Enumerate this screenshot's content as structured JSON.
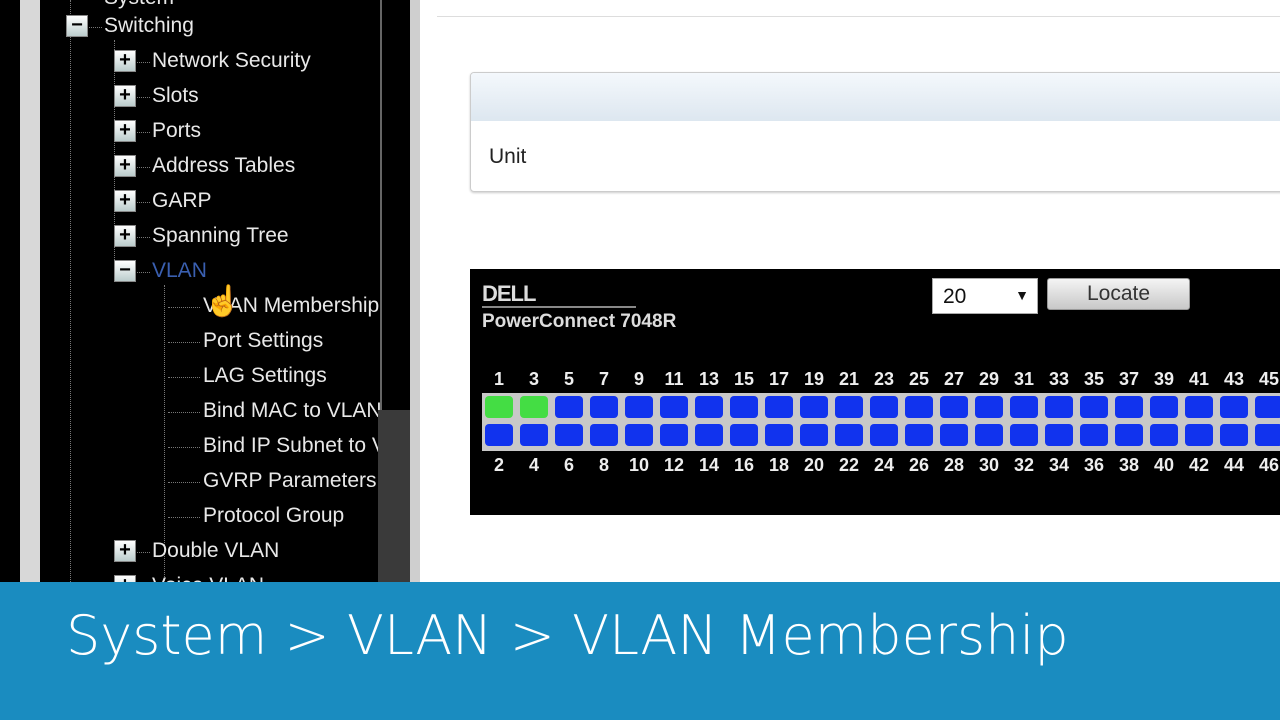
{
  "tree": {
    "top_partial": "System",
    "items": [
      {
        "label": "Switching",
        "level": 0,
        "expander": "minus"
      },
      {
        "label": "Network Security",
        "level": 1,
        "expander": "plus"
      },
      {
        "label": "Slots",
        "level": 1,
        "expander": "plus"
      },
      {
        "label": "Ports",
        "level": 1,
        "expander": "plus"
      },
      {
        "label": "Address Tables",
        "level": 1,
        "expander": "plus"
      },
      {
        "label": "GARP",
        "level": 1,
        "expander": "plus"
      },
      {
        "label": "Spanning Tree",
        "level": 1,
        "expander": "plus"
      },
      {
        "label": "VLAN",
        "level": 1,
        "expander": "minus",
        "selected": true
      },
      {
        "label": "VLAN Membership",
        "level": 2
      },
      {
        "label": "Port Settings",
        "level": 2
      },
      {
        "label": "LAG Settings",
        "level": 2
      },
      {
        "label": "Bind MAC to VLAN",
        "level": 2
      },
      {
        "label": "Bind IP Subnet to VLAN",
        "level": 2
      },
      {
        "label": "GVRP Parameters",
        "level": 2
      },
      {
        "label": "Protocol Group",
        "level": 2
      },
      {
        "label": "Double VLAN",
        "level": 1,
        "expander": "plus"
      },
      {
        "label": "Voice VLAN",
        "level": 1,
        "expander": "plus"
      }
    ]
  },
  "panel": {
    "label": "Unit"
  },
  "switch": {
    "brand": "DELL",
    "model": "PowerConnect 7048R",
    "unit_select": "20",
    "locate_label": "Locate",
    "active_ports": [
      1,
      3
    ],
    "active_color": "#44dd44",
    "inactive_color": "#1133ee"
  },
  "caption": "System > VLAN > VLAN Membership"
}
